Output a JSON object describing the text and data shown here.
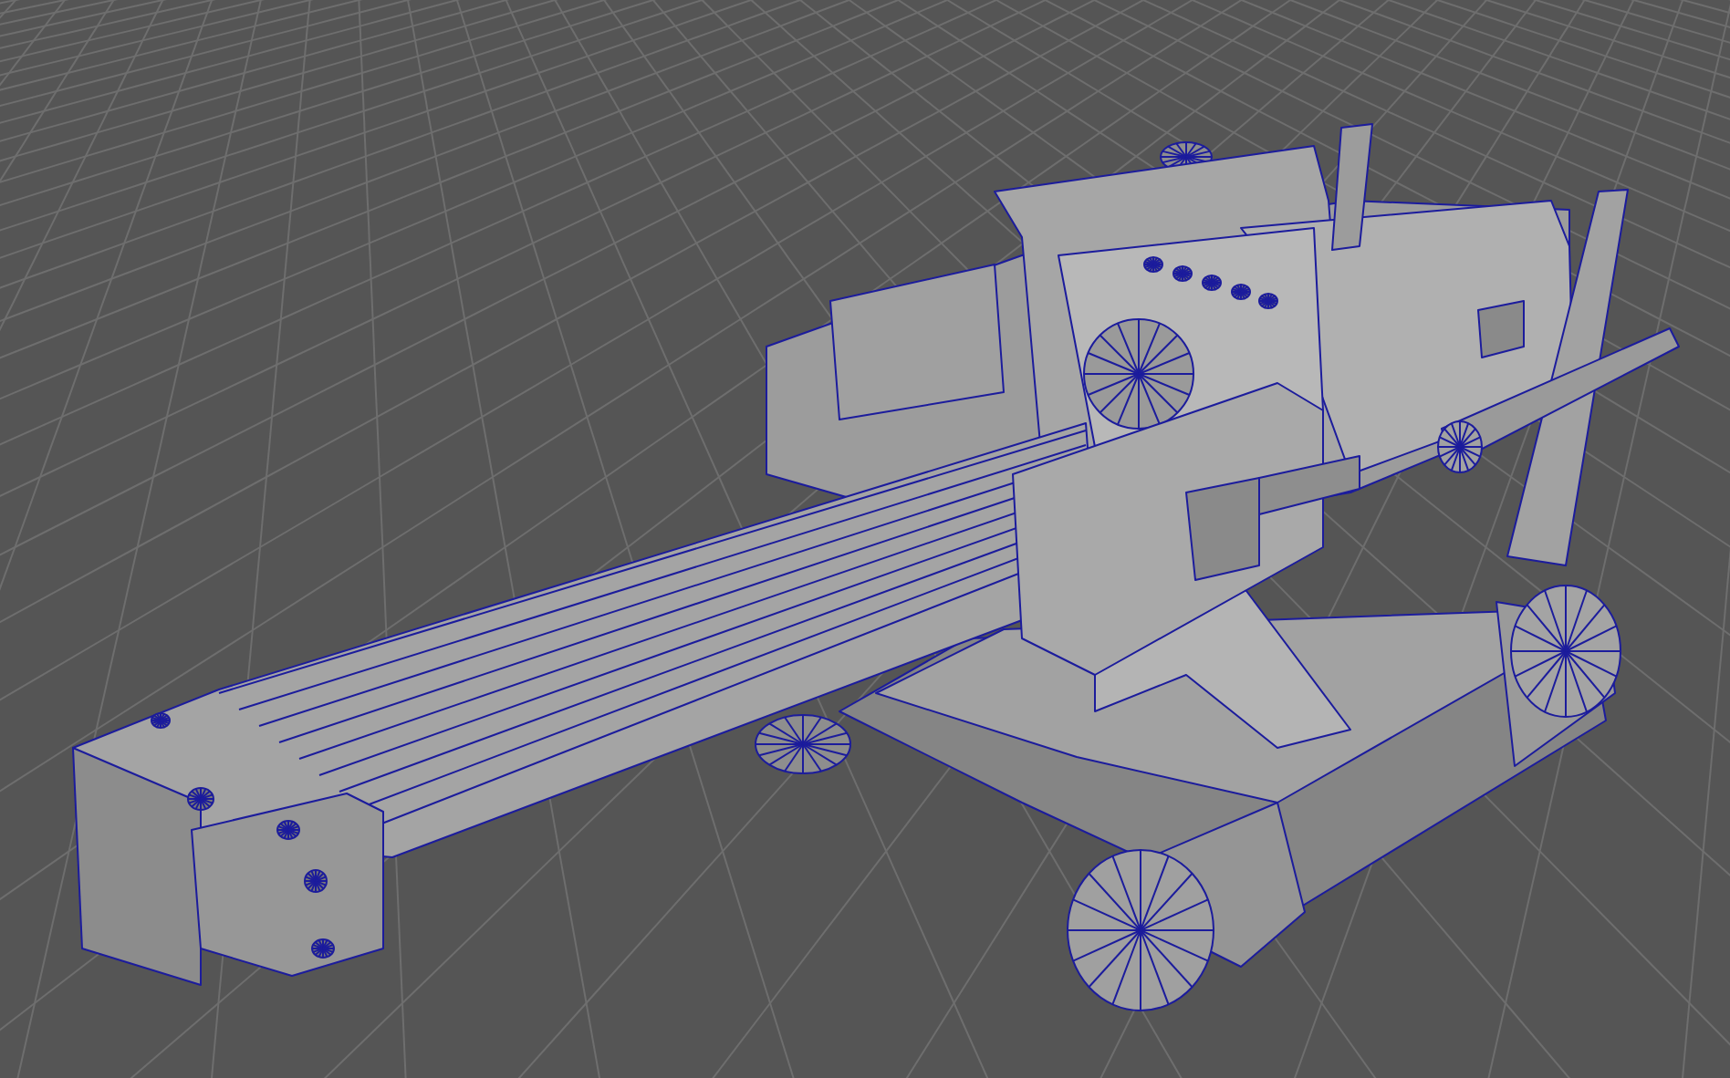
{
  "viewport": {
    "kind": "wireframe_on_shaded"
  }
}
